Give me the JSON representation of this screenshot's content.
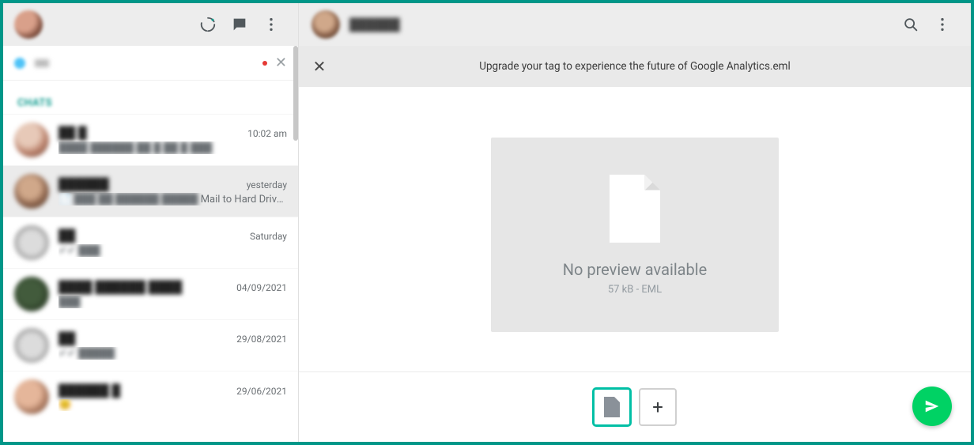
{
  "left": {
    "tab": "CHATS",
    "chats": [
      {
        "name": "██ █",
        "snippet_blur": "████ ██████ ██ █ ██ █ ███",
        "snippet_sharp": "",
        "time": "10:02 am",
        "avatar": "radial-gradient(circle at 40% 35%, #e7c9b8 0 35%, #b9806a 60%, #5b3a2d)"
      },
      {
        "name": "██████",
        "snippet_blur": "📄 ███ ██ ██████ █████ ",
        "snippet_sharp": "Mail to Hard Drive Wit…",
        "time": "yesterday",
        "avatar": "radial-gradient(circle at 45% 40%, #d0a88a 0 35%, #886049 60%, #3a2a1e)"
      },
      {
        "name": "██",
        "snippet_blur": "✔✔ ███",
        "snippet_sharp": "",
        "time": "Saturday",
        "avatar": "radial-gradient(circle at 50% 50%, #dcdcdc 0 45%, #9e9e9e 70%, #6f6f6f)"
      },
      {
        "name": "████ ██████ ████",
        "snippet_blur": "███",
        "snippet_sharp": "",
        "time": "04/09/2021",
        "avatar": "radial-gradient(circle at 45% 45%, #425b3c 0 40%, #2e4029 70%, #1c2718)"
      },
      {
        "name": "██",
        "snippet_blur": "✔✔ █████",
        "snippet_sharp": "",
        "time": "29/08/2021",
        "avatar": "radial-gradient(circle at 50% 50%, #dcdcdc 0 45%, #9e9e9e 70%, #6f6f6f)"
      },
      {
        "name": "██████ █",
        "snippet_blur": "😊",
        "snippet_sharp": "",
        "time": "29/06/2021",
        "avatar": "radial-gradient(circle at 40% 40%, #e5b69a 0 40%, #9c6b52 70%, #4e3528)"
      }
    ]
  },
  "right": {
    "contact": "██████",
    "file_title": "Upgrade your tag to experience the future of Google Analytics.eml",
    "no_preview": "No preview available",
    "file_meta": "57 kB - EML",
    "add_label": "+"
  }
}
